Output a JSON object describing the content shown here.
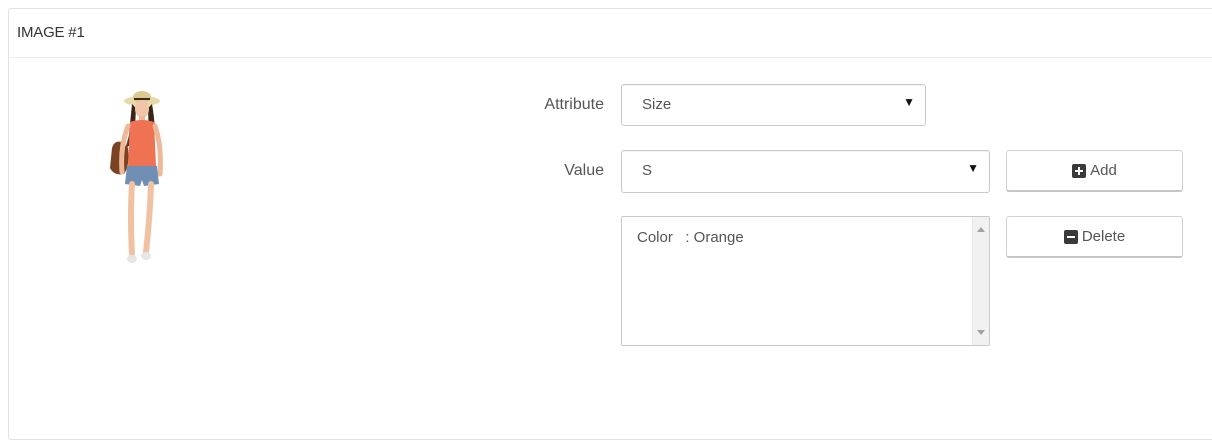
{
  "panel": {
    "title": "IMAGE #1"
  },
  "form": {
    "attribute_label": "Attribute",
    "attribute_selected": "Size",
    "value_label": "Value",
    "value_selected": "S",
    "combinations": [
      "Color   : Orange"
    ],
    "add_label": "Add",
    "delete_label": "Delete"
  },
  "icons": {
    "add": "plus-square-icon",
    "delete": "minus-square-icon",
    "select_caret": "caret-down-icon",
    "scroll_up": "scroll-up-arrow-icon",
    "scroll_down": "scroll-down-arrow-icon"
  },
  "colors": {
    "panel_border": "#e2e2e2",
    "text": "#555555",
    "icon": "#3a3a3a"
  }
}
